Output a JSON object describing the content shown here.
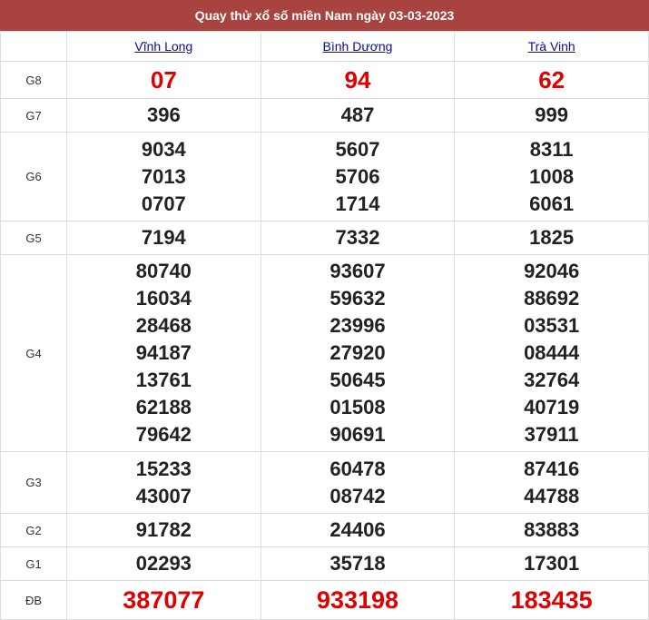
{
  "title": "Quay thử xổ số miền Nam ngày 03-03-2023",
  "provinces": [
    "Vĩnh Long",
    "Bình Dương",
    "Trà Vinh"
  ],
  "rows": {
    "g8": {
      "label": "G8",
      "values": [
        "07",
        "94",
        "62"
      ]
    },
    "g7": {
      "label": "G7",
      "values": [
        "396",
        "487",
        "999"
      ]
    },
    "g6": {
      "label": "G6",
      "values": [
        [
          "9034",
          "7013",
          "0707"
        ],
        [
          "5607",
          "5706",
          "1714"
        ],
        [
          "8311",
          "1008",
          "6061"
        ]
      ]
    },
    "g5": {
      "label": "G5",
      "values": [
        "7194",
        "7332",
        "1825"
      ]
    },
    "g4": {
      "label": "G4",
      "values": [
        [
          "80740",
          "16034",
          "28468",
          "94187",
          "13761",
          "62188",
          "79642"
        ],
        [
          "93607",
          "59632",
          "23996",
          "27920",
          "50645",
          "01508",
          "90691"
        ],
        [
          "92046",
          "88692",
          "03531",
          "08444",
          "32764",
          "40719",
          "37911"
        ]
      ]
    },
    "g3": {
      "label": "G3",
      "values": [
        [
          "15233",
          "43007"
        ],
        [
          "60478",
          "08742"
        ],
        [
          "87416",
          "44788"
        ]
      ]
    },
    "g2": {
      "label": "G2",
      "values": [
        "91782",
        "24406",
        "83883"
      ]
    },
    "g1": {
      "label": "G1",
      "values": [
        "02293",
        "35718",
        "17301"
      ]
    },
    "db": {
      "label": "ĐB",
      "values": [
        "387077",
        "933198",
        "183435"
      ]
    }
  },
  "colors": {
    "header_bg": "#a8433f",
    "special_red": "#e00000",
    "link": "#0b0b9a"
  }
}
